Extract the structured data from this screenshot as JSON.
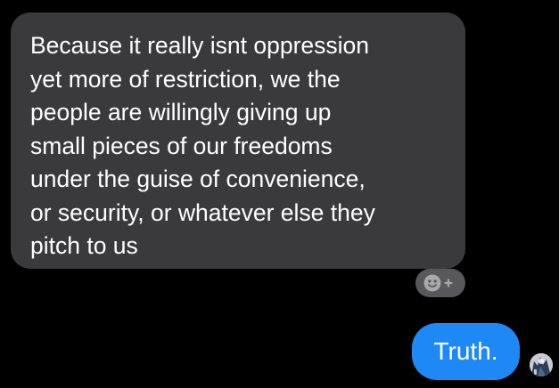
{
  "conversation": {
    "incoming_message": {
      "lines": [
        "Because it really isnt oppression",
        "yet more of restriction, we the",
        "people are willingly giving up",
        "small pieces of our freedoms",
        "under the guise of convenience,",
        "or security, or whatever else they",
        "pitch to us"
      ]
    },
    "reaction_button": {
      "icon": "add-reaction-icon"
    },
    "outgoing_message": {
      "text": "Truth."
    },
    "avatar": {
      "icon": "user-avatar"
    }
  },
  "colors": {
    "background": "#000000",
    "incoming_bubble": "#3a3a3c",
    "outgoing_bubble": "#1e88f5",
    "reaction_button": "#58585a",
    "text": "#ffffff"
  }
}
